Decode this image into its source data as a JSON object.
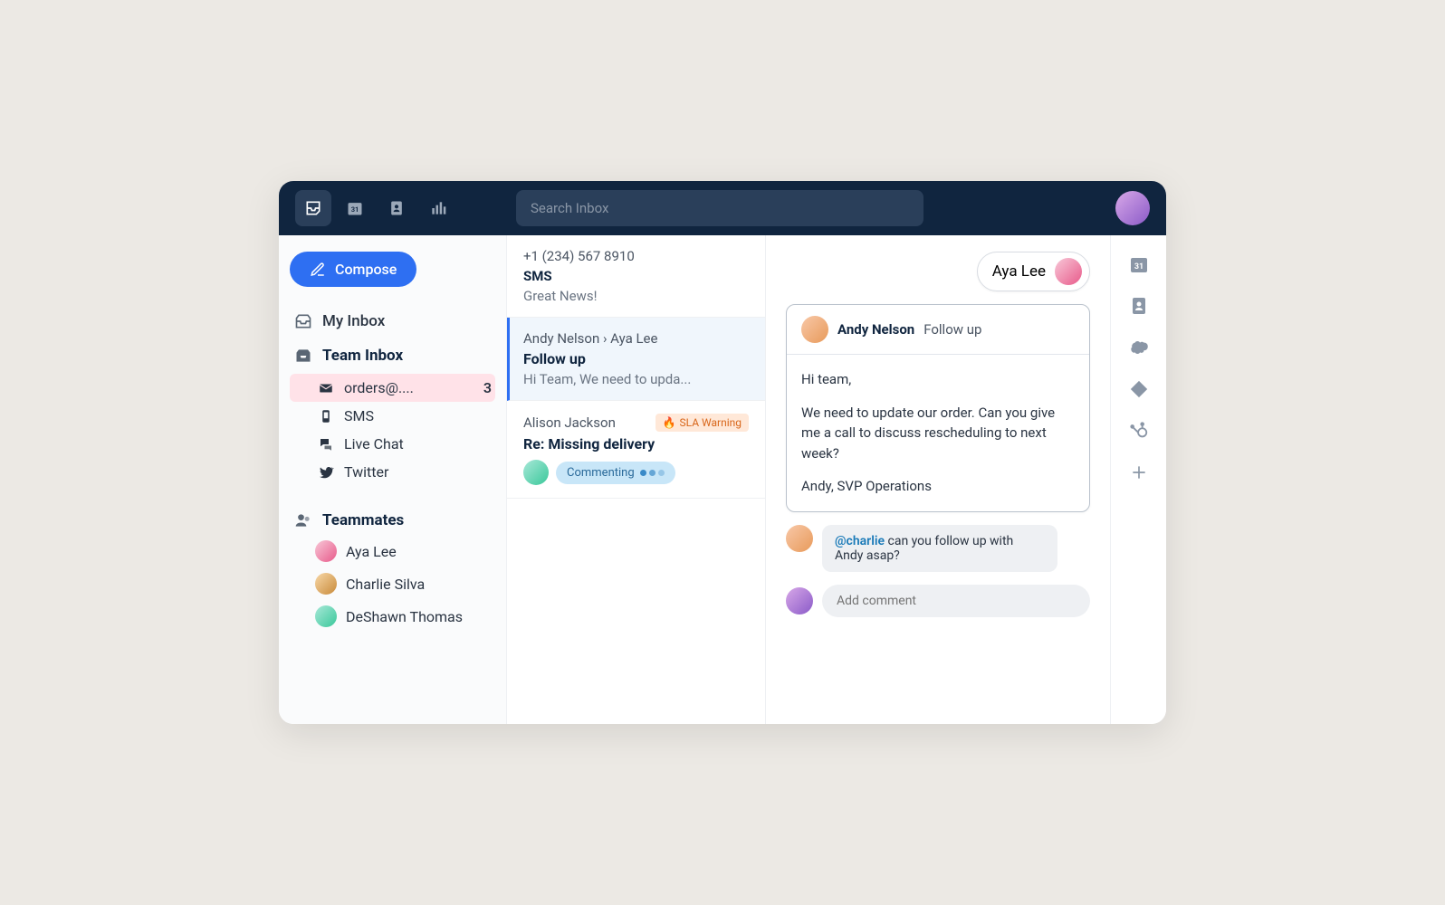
{
  "topbar": {
    "search_placeholder": "Search Inbox",
    "calendar_day": "31"
  },
  "sidebar": {
    "compose_label": "Compose",
    "my_inbox_label": "My Inbox",
    "team_inbox_label": "Team Inbox",
    "team_items": [
      {
        "label": "orders@....",
        "count": "3",
        "icon": "mail"
      },
      {
        "label": "SMS",
        "icon": "phone"
      },
      {
        "label": "Live Chat",
        "icon": "chat"
      },
      {
        "label": "Twitter",
        "icon": "twitter"
      }
    ],
    "teammates_label": "Teammates",
    "teammates": [
      {
        "name": "Aya Lee"
      },
      {
        "name": "Charlie Silva"
      },
      {
        "name": "DeShawn Thomas"
      }
    ]
  },
  "threads": [
    {
      "from": "+1 (234) 567 8910",
      "channel": "SMS",
      "preview": "Great News!"
    },
    {
      "from": "Andy Nelson › Aya Lee",
      "subject": "Follow up",
      "preview": "Hi Team, We need to upda...",
      "selected": true
    },
    {
      "from": "Alison Jackson",
      "subject": "Re: Missing delivery",
      "sla_label": "SLA Warning",
      "commenting_label": "Commenting"
    }
  ],
  "conversation": {
    "assignee": "Aya Lee",
    "message": {
      "sender": "Andy Nelson",
      "subject": "Follow up",
      "greeting": "Hi team,",
      "body": "We need to update our order. Can you give me a call to discuss rescheduling to next week?",
      "signature": "Andy, SVP Operations"
    },
    "comment": {
      "mention": "@charlie",
      "text": " can you follow up with Andy asap?"
    },
    "comment_placeholder": "Add comment"
  },
  "rightbar": {
    "calendar_day": "31"
  }
}
